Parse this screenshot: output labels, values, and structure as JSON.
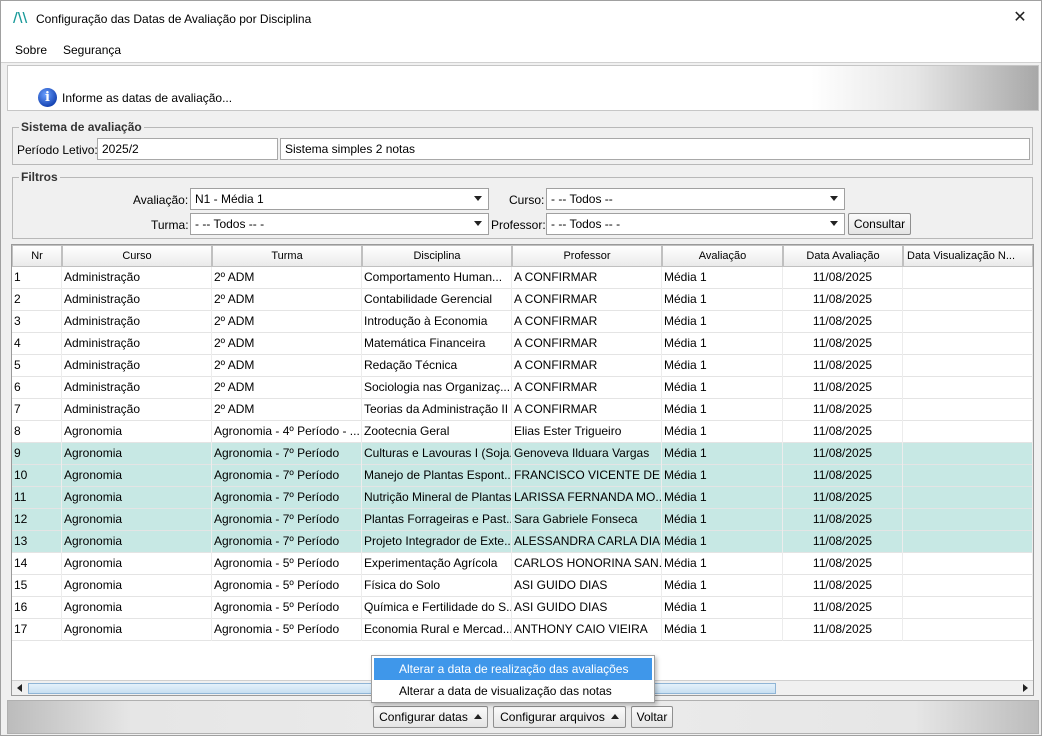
{
  "window": {
    "title": "Configuração das Datas de Avaliação por Disciplina",
    "logo": "/\\\\",
    "close": "✕"
  },
  "menu": {
    "items": [
      {
        "label": "Sobre"
      },
      {
        "label": "Segurança"
      }
    ]
  },
  "info": {
    "icon": "i",
    "text": "Informe as datas de avaliação..."
  },
  "sistema": {
    "legend": "Sistema de avaliação",
    "periodo_label": "Período Letivo:",
    "periodo_value": "2025/2",
    "code_value": "",
    "sistema_value": "Sistema simples 2 notas"
  },
  "filtros": {
    "legend": "Filtros",
    "avaliacao_label": "Avaliação:",
    "avaliacao_value": "N1 - Média 1",
    "curso_label": "Curso:",
    "curso_value": "- -- Todos --",
    "turma_label": "Turma:",
    "turma_value": "- -- Todos -- -",
    "professor_label": "Professor:",
    "professor_value": "- -- Todos -- -",
    "consultar_label": "Consultar"
  },
  "table": {
    "headers": [
      "Nr",
      "Curso",
      "Turma",
      "Disciplina",
      "Professor",
      "Avaliação",
      "Data Avaliação",
      "Data Visualização N..."
    ],
    "rows": [
      {
        "nr": "1",
        "curso": "Administração",
        "turma": "2º ADM",
        "disciplina": "Comportamento Human...",
        "professor": "A CONFIRMAR",
        "avaliacao": "Média 1",
        "data": "11/08/2025",
        "visualizacao": "",
        "selected": false
      },
      {
        "nr": "2",
        "curso": "Administração",
        "turma": "2º ADM",
        "disciplina": "Contabilidade Gerencial",
        "professor": "A CONFIRMAR",
        "avaliacao": "Média 1",
        "data": "11/08/2025",
        "visualizacao": "",
        "selected": false
      },
      {
        "nr": "3",
        "curso": "Administração",
        "turma": "2º ADM",
        "disciplina": "Introdução à Economia",
        "professor": "A CONFIRMAR",
        "avaliacao": "Média 1",
        "data": "11/08/2025",
        "visualizacao": "",
        "selected": false
      },
      {
        "nr": "4",
        "curso": "Administração",
        "turma": "2º ADM",
        "disciplina": "Matemática Financeira",
        "professor": "A CONFIRMAR",
        "avaliacao": "Média 1",
        "data": "11/08/2025",
        "visualizacao": "",
        "selected": false
      },
      {
        "nr": "5",
        "curso": "Administração",
        "turma": "2º ADM",
        "disciplina": "Redação Técnica",
        "professor": "A CONFIRMAR",
        "avaliacao": "Média 1",
        "data": "11/08/2025",
        "visualizacao": "",
        "selected": false
      },
      {
        "nr": "6",
        "curso": "Administração",
        "turma": "2º ADM",
        "disciplina": "Sociologia nas Organizaç...",
        "professor": "A CONFIRMAR",
        "avaliacao": "Média 1",
        "data": "11/08/2025",
        "visualizacao": "",
        "selected": false
      },
      {
        "nr": "7",
        "curso": "Administração",
        "turma": "2º ADM",
        "disciplina": "Teorias da Administração II",
        "professor": "A CONFIRMAR",
        "avaliacao": "Média 1",
        "data": "11/08/2025",
        "visualizacao": "",
        "selected": false
      },
      {
        "nr": "8",
        "curso": "Agronomia",
        "turma": "Agronomia - 4º Período - ...",
        "disciplina": "Zootecnia Geral",
        "professor": "Elias Ester Trigueiro",
        "avaliacao": "Média 1",
        "data": "11/08/2025",
        "visualizacao": "",
        "selected": false
      },
      {
        "nr": "9",
        "curso": "Agronomia",
        "turma": "Agronomia - 7º Período",
        "disciplina": "Culturas e Lavouras I (Soja...",
        "professor": "Genoveva Ilduara Vargas",
        "avaliacao": "Média 1",
        "data": "11/08/2025",
        "visualizacao": "",
        "selected": true
      },
      {
        "nr": "10",
        "curso": "Agronomia",
        "turma": "Agronomia - 7º Período",
        "disciplina": "Manejo de Plantas Espont...",
        "professor": "FRANCISCO VICENTE DE L...",
        "avaliacao": "Média 1",
        "data": "11/08/2025",
        "visualizacao": "",
        "selected": true
      },
      {
        "nr": "11",
        "curso": "Agronomia",
        "turma": "Agronomia - 7º Período",
        "disciplina": "Nutrição Mineral de Plantas",
        "professor": "LARISSA FERNANDA MO...",
        "avaliacao": "Média 1",
        "data": "11/08/2025",
        "visualizacao": "",
        "selected": true
      },
      {
        "nr": "12",
        "curso": "Agronomia",
        "turma": "Agronomia - 7º Período",
        "disciplina": "Plantas Forrageiras e Past...",
        "professor": "Sara Gabriele Fonseca",
        "avaliacao": "Média 1",
        "data": "11/08/2025",
        "visualizacao": "",
        "selected": true
      },
      {
        "nr": "13",
        "curso": "Agronomia",
        "turma": "Agronomia - 7º Período",
        "disciplina": "Projeto Integrador de Exte...",
        "professor": "ALESSANDRA CARLA DIAS",
        "avaliacao": "Média 1",
        "data": "11/08/2025",
        "visualizacao": "",
        "selected": true
      },
      {
        "nr": "14",
        "curso": "Agronomia",
        "turma": "Agronomia - 5º Período",
        "disciplina": "Experimentação Agrícola",
        "professor": "CARLOS HONORINA SAN...",
        "avaliacao": "Média 1",
        "data": "11/08/2025",
        "visualizacao": "",
        "selected": false
      },
      {
        "nr": "15",
        "curso": "Agronomia",
        "turma": "Agronomia - 5º Período",
        "disciplina": "Física do Solo",
        "professor": "ASI GUIDO DIAS",
        "avaliacao": "Média 1",
        "data": "11/08/2025",
        "visualizacao": "",
        "selected": false
      },
      {
        "nr": "16",
        "curso": "Agronomia",
        "turma": "Agronomia - 5º Período",
        "disciplina": "Química e Fertilidade do S...",
        "professor": "ASI GUIDO DIAS",
        "avaliacao": "Média 1",
        "data": "11/08/2025",
        "visualizacao": "",
        "selected": false
      },
      {
        "nr": "17",
        "curso": "Agronomia",
        "turma": "Agronomia - 5º Período",
        "disciplina": "Economia Rural e Mercad...",
        "professor": "ANTHONY CAIO VIEIRA",
        "avaliacao": "Média 1",
        "data": "11/08/2025",
        "visualizacao": "",
        "selected": false
      }
    ]
  },
  "popup": {
    "items": [
      {
        "label": "Alterar a data de realização das avaliações",
        "highlighted": true
      },
      {
        "label": "Alterar a data de visualização das notas",
        "highlighted": false
      }
    ]
  },
  "bottom": {
    "configurar_datas": "Configurar datas",
    "configurar_arquivos": "Configurar arquivos",
    "voltar": "Voltar"
  },
  "colors": {
    "selected_row": "#c7e8e4",
    "popup_highlight": "#3f97ea",
    "logo": "#1a9a9a"
  }
}
